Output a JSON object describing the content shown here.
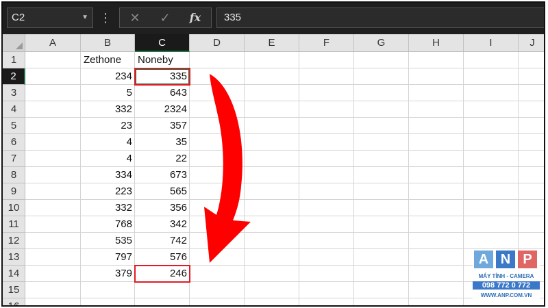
{
  "formula_bar": {
    "name_box": "C2",
    "name_box_dropdown_icon": "chevron-down-icon",
    "more_icon": "vertical-dots-icon",
    "cancel_icon": "close-icon",
    "enter_icon": "check-icon",
    "cancel_glyph": "✕",
    "enter_glyph": "✓",
    "fx_label": "fx",
    "formula_value": "335"
  },
  "columns": [
    "A",
    "B",
    "C",
    "D",
    "E",
    "F",
    "G",
    "H",
    "I",
    "J"
  ],
  "selected_column": "C",
  "rows": [
    "1",
    "2",
    "3",
    "4",
    "5",
    "6",
    "7",
    "8",
    "9",
    "10",
    "11",
    "12",
    "13",
    "14",
    "15",
    "16"
  ],
  "selected_row": "2",
  "headers": {
    "b1": "Zethone",
    "c1": "Noneby"
  },
  "zethone": [
    "234",
    "5",
    "332",
    "23",
    "4",
    "4",
    "334",
    "223",
    "332",
    "768",
    "535",
    "797",
    "379"
  ],
  "noneby": [
    "335",
    "643",
    "2324",
    "357",
    "35",
    "22",
    "673",
    "565",
    "356",
    "342",
    "742",
    "576",
    "246"
  ],
  "annotation": {
    "highlight_color": "#e01b24",
    "arrow_color": "#ff0000"
  },
  "watermark": {
    "letters": [
      "A",
      "N",
      "P"
    ],
    "line1": "MÁY TÍNH - CAMERA",
    "line2": "098 772 0 772",
    "line3": "WWW.ANP.COM.VN"
  },
  "colors": {
    "accent": "#217346",
    "header_dark": "#1f1f1f"
  }
}
